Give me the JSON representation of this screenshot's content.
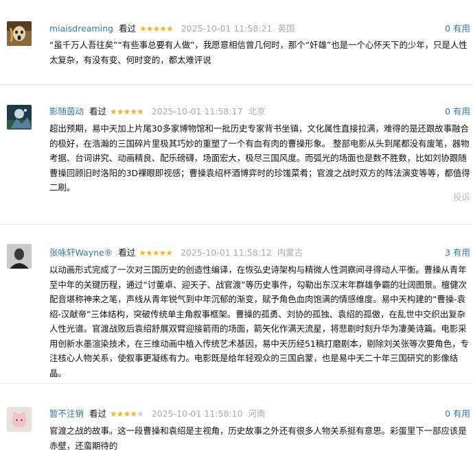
{
  "reviews": [
    {
      "user": "miaisdreaming",
      "rated": "看过",
      "stars": 5,
      "time": "2025-10-01 11:58:21",
      "location": "英国",
      "useful": "0 有用",
      "text": "“虽千万人吾往矣”“有些事总要有人做”，我愿意相信曾几何时，那个“奸雄”也是一个心怀天下的少年，只是人性太复杂，有没有变、何时变的，都太难评说"
    },
    {
      "user": "影随茵动",
      "rated": "看过",
      "stars": 5,
      "time": "2025-10-01 11:58:17",
      "location": "北京",
      "useful": "0 有用",
      "text": "超出预期，易中天加上片尾30多家博物馆和一批历史专家背书坐镇，文化属性直接拉满，难得的是还跟故事融合的极好，在浩瀚的三国碎片里极其巧妙的重塑了一个有血有肉的曹操形象。 整部电影从头到尾都没有废笔，器物考据、台词讲究、动画精良、配乐磅礴，场面宏大，极尽三国风度。而弧光的场面也是数不胜数，比如刘协跟随曹操回顾旧时洛阳的3D裸眼即视感；曹操袁绍杯酒博弈时的珍馐菜肴；官渡之战时双方的阵法演变等等，都值得二刷。",
      "report": "投诉"
    },
    {
      "user": "张咏轩Wayne®",
      "rated": "看过",
      "stars": 5,
      "time": "2025-10-01 11:58:12",
      "location": "内蒙古",
      "useful": "3 有用",
      "text": "以动画形式完成了一次对三国历史的创造性编译，在恢弘史诗架构与精微人性洞察间寻得动人平衡。曹操从青年至中年的关键历程，通过“讨董卓、迎天子、战官渡”等历史事件，勾勒出东汉末年群雄争霸的壮阔图景。檀健次配音堪称神来之笔，声线从青年锐气到中年沉郁的渐变，赋予角色血肉饱满的情感维度。易中天构建的“曹操-袁绍-汉献帝”三体结构，突破传统单主角叙事框架。曹操的孤勇、刘协的孤独、袁绍的孤傲，在乱世中交织出复杂人性光谱。官渡战败后袁绍舒展双臂迎接箭雨的场面，箭矢化作满天流星，将悲剧时刻升华为凄美诗篇。电影采用创新水墨渲染技术，在三维动画中植入传统艺术基因，易中天历经51稿打磨剧本，剔除刘关张等次要角色，专注核心人物关系，使叙事更凝练有力。电影既是给年轻观众的三国启蒙，也是易中天二十年三国研究的影像结晶。"
    },
    {
      "user": "暂不注销",
      "rated": "看过",
      "stars": 4,
      "time": "2025-10-01 11:58:10",
      "location": "河南",
      "useful": "0 有用",
      "text": "官渡之战的故事。这一段曹操和袁绍是主视角，历史故事之外还有很多人物关系挺有意思。彩蛋里下一部应该是赤壁，还蛮期待的"
    }
  ]
}
